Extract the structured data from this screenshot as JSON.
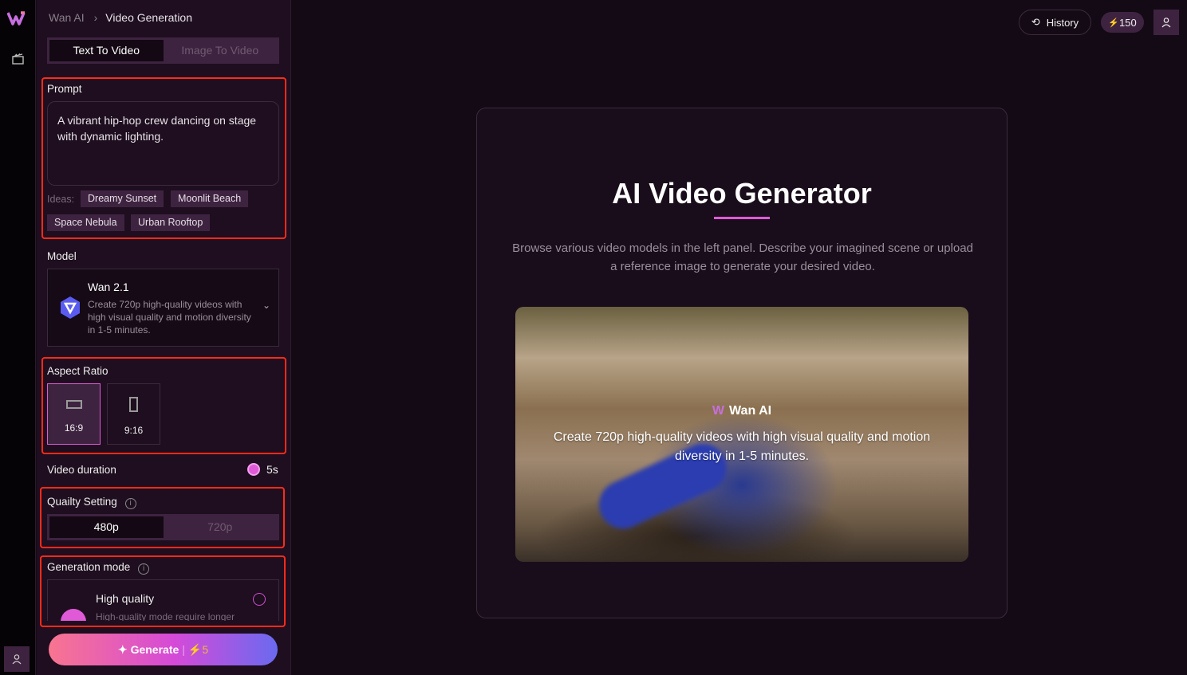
{
  "breadcrumb": {
    "root": "Wan AI",
    "current": "Video Generation"
  },
  "mode_tabs": [
    "Text To Video",
    "Image To Video"
  ],
  "prompt": {
    "label": "Prompt",
    "value": "A vibrant hip-hop crew dancing on stage with dynamic lighting.",
    "ideas_label": "Ideas:",
    "ideas": [
      "Dreamy Sunset",
      "Moonlit Beach",
      "Space Nebula",
      "Urban Rooftop"
    ]
  },
  "model": {
    "label": "Model",
    "name": "Wan 2.1",
    "description": "Create 720p high-quality videos with high visual quality and motion diversity in 1-5 minutes."
  },
  "aspect": {
    "label": "Aspect Ratio",
    "options": [
      "16:9",
      "9:16"
    ],
    "selected": "16:9"
  },
  "duration": {
    "label": "Video duration",
    "value": "5s"
  },
  "quality": {
    "label": "Quailty Setting",
    "options": [
      "480p",
      "720p"
    ],
    "selected": "480p"
  },
  "generation_mode": {
    "label": "Generation mode",
    "option_title": "High quality",
    "option_desc": "High-quality mode require longer"
  },
  "generate": {
    "label": "Generate",
    "cost": "5"
  },
  "header": {
    "history": "History",
    "credits": "150"
  },
  "main": {
    "title": "AI Video Generator",
    "subtitle": "Browse various video models in the left panel. Describe your imagined scene or upload a reference image to generate your desired video.",
    "preview_brand": "Wan AI",
    "preview_caption": "Create 720p high-quality videos with high visual quality and motion diversity in 1-5 minutes."
  },
  "colors": {
    "accent": "#e05ad8",
    "annotation": "#ff2a1a",
    "credit": "#f5b73b"
  }
}
